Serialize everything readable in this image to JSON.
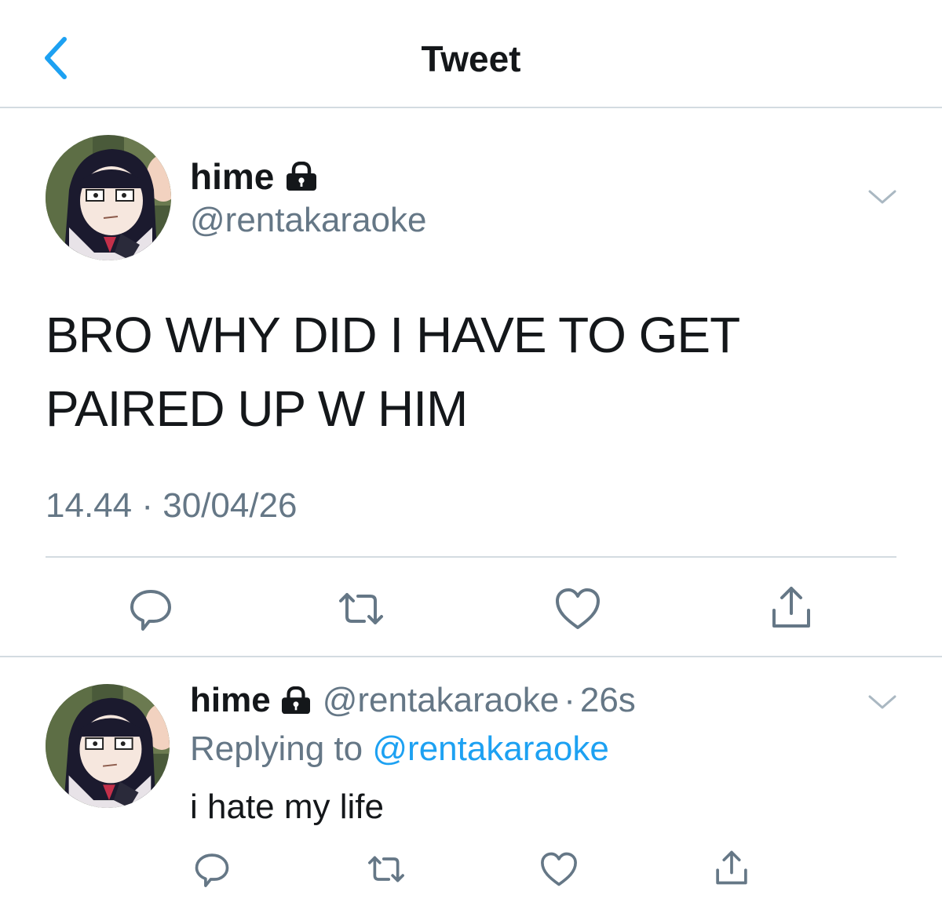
{
  "header": {
    "title": "Tweet"
  },
  "tweet": {
    "display_name": "hime",
    "handle": "@rentakaraoke",
    "text": "BRO WHY DID I HAVE TO GET PAIRED UP W HIM",
    "time": "14.44",
    "separator": "·",
    "date": "30/04/26"
  },
  "reply": {
    "display_name": "hime",
    "handle": "@rentakaraoke",
    "separator": "·",
    "age": "26s",
    "replying_prefix": "Replying to",
    "replying_handle": "@rentakaraoke",
    "text": "i hate my life"
  },
  "icons": {
    "back": "chevron-left-icon",
    "lock": "lock-icon",
    "menu": "chevron-down-icon",
    "reply": "comment-bubble-icon",
    "retweet": "retweet-icon",
    "like": "heart-icon",
    "share": "share-upload-icon"
  },
  "colors": {
    "accent": "#1da1f2",
    "text": "#14171a",
    "secondary": "#657786",
    "divider": "#d3dbe1"
  }
}
